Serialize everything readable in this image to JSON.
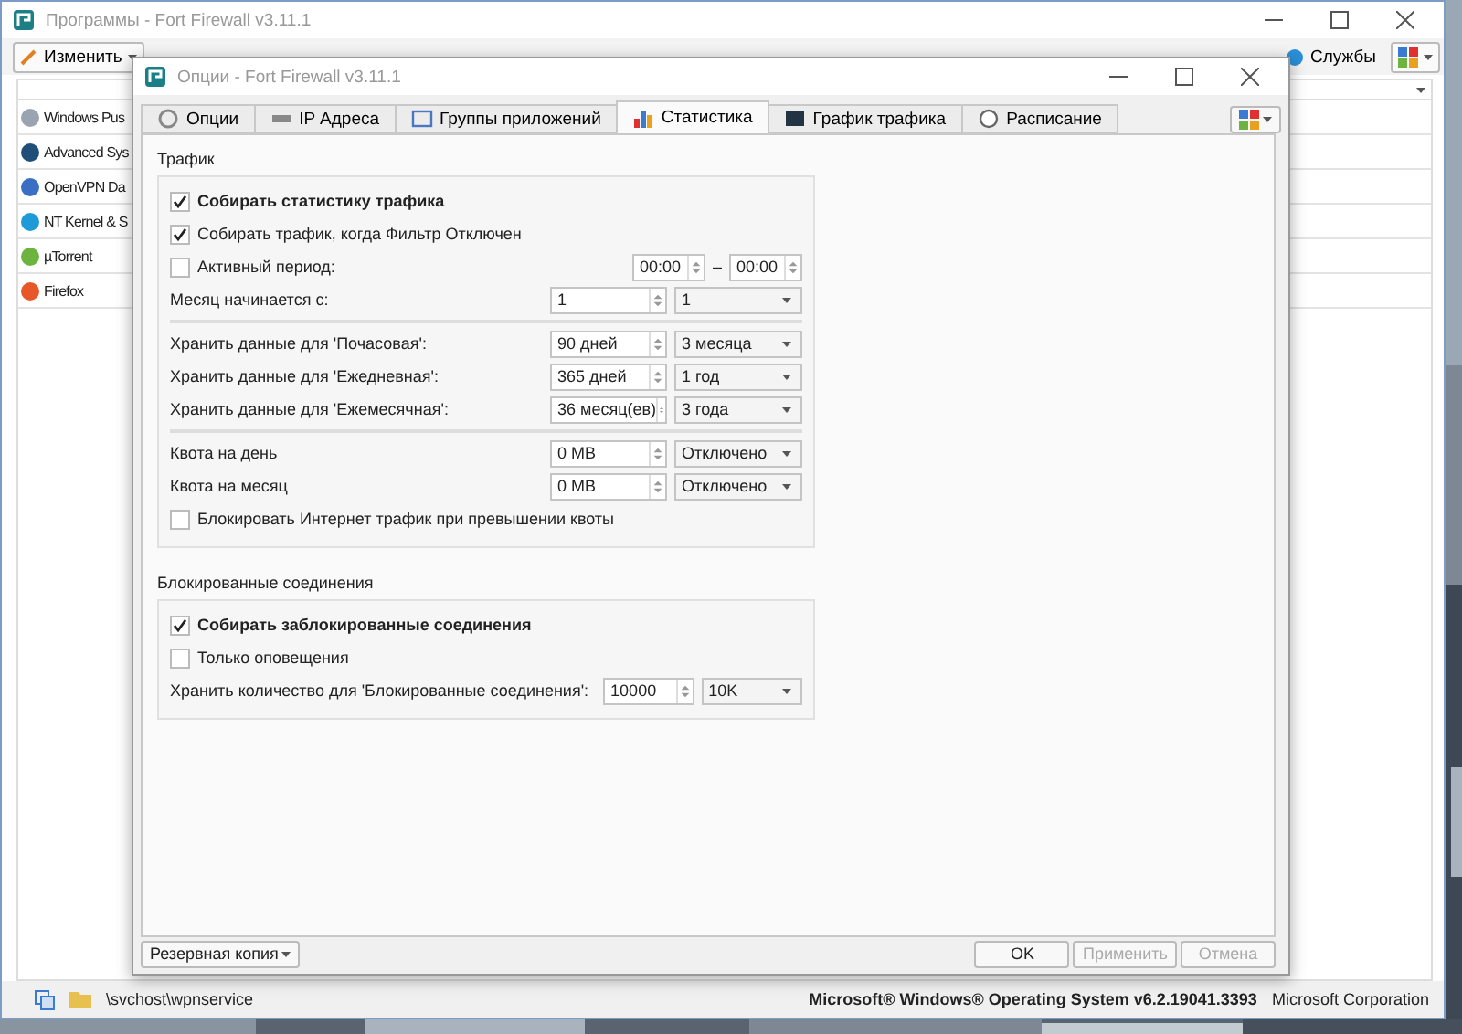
{
  "main_window": {
    "title": "Программы - Fort Firewall v3.11.1",
    "toolbar": {
      "edit_button": "Изменить",
      "services_button": "Службы"
    },
    "programs": [
      {
        "name": "Windows Pus",
        "color": "#9aa4b0"
      },
      {
        "name": "Advanced Sys",
        "color": "#1f4e79"
      },
      {
        "name": "OpenVPN Da",
        "color": "#3a6fc4"
      },
      {
        "name": "NT Kernel & S",
        "color": "#1e9bd7"
      },
      {
        "name": "µTorrent",
        "color": "#6cb33f"
      },
      {
        "name": "Firefox",
        "color": "#e8572a"
      }
    ],
    "status_bar": {
      "path": "\\svchost\\wpnservice",
      "product": "Microsoft® Windows® Operating System v6.2.19041.3393",
      "company": "Microsoft Corporation"
    }
  },
  "dialog": {
    "title": "Опции - Fort Firewall v3.11.1",
    "tabs": [
      {
        "label": "Опции",
        "selected": false
      },
      {
        "label": "IP Адреса",
        "selected": false
      },
      {
        "label": "Группы приложений",
        "selected": false
      },
      {
        "label": "Статистика",
        "selected": true
      },
      {
        "label": "График трафика",
        "selected": false
      },
      {
        "label": "Расписание",
        "selected": false
      }
    ],
    "sections": [
      {
        "title": "Трафик",
        "rows": [
          {
            "kind": "checkbox",
            "label": "Собирать статистику трафика",
            "checked": true,
            "bold": true
          },
          {
            "kind": "checkbox",
            "label": "Собирать трафик, когда Фильтр Отключен",
            "checked": true,
            "bold": false
          },
          {
            "kind": "period",
            "label": "Активный период:",
            "checked": false,
            "from": "00:00",
            "to": "00:00",
            "dash": "–"
          },
          {
            "kind": "setting",
            "label": "Месяц начинается с:",
            "spin": "1",
            "combo": "1"
          },
          {
            "kind": "separator"
          },
          {
            "kind": "setting",
            "label": "Хранить данные для 'Почасовая':",
            "spin": "90 дней",
            "combo": "3 месяца"
          },
          {
            "kind": "setting",
            "label": "Хранить данные для 'Ежедневная':",
            "spin": "365 дней",
            "combo": "1 год"
          },
          {
            "kind": "setting",
            "label": "Хранить данные для 'Ежемесячная':",
            "spin": "36 месяц(ев)",
            "combo": "3 года"
          },
          {
            "kind": "separator"
          },
          {
            "kind": "setting",
            "label": "Квота на день",
            "spin": "0 MB",
            "combo": "Отключено"
          },
          {
            "kind": "setting",
            "label": "Квота на месяц",
            "spin": "0 MB",
            "combo": "Отключено"
          },
          {
            "kind": "checkbox",
            "label": "Блокировать Интернет трафик при превышении квоты",
            "checked": false,
            "bold": false
          }
        ]
      },
      {
        "title": "Блокированные соединения",
        "rows": [
          {
            "kind": "checkbox",
            "label": "Собирать заблокированные соединения",
            "checked": true,
            "bold": true
          },
          {
            "kind": "checkbox",
            "label": "Только оповещения",
            "checked": false,
            "bold": false
          },
          {
            "kind": "setting",
            "label": "Хранить количество для 'Блокированные соединения':",
            "spin": "10000",
            "combo": "10K"
          }
        ]
      }
    ],
    "footer": {
      "backup_button": "Резервная копия",
      "buttons": [
        {
          "label": "OK",
          "disabled": false
        },
        {
          "label": "Применить",
          "disabled": true
        },
        {
          "label": "Отмена",
          "disabled": true
        }
      ]
    }
  }
}
